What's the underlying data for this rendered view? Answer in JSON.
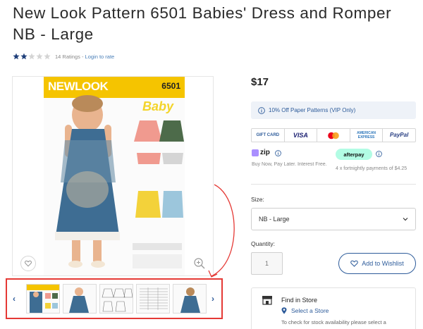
{
  "product": {
    "title": "New Look Pattern 6501 Babies' Dress and Romper NB - Large",
    "rating_stars_filled": 2,
    "rating_stars_total": 5,
    "ratings_text": "14 Ratings - ",
    "login_text": "Login to rate",
    "price": "$17"
  },
  "cover": {
    "brand": "NEWLOOK",
    "number": "6501",
    "baby": "Baby"
  },
  "promo": {
    "vip_text": "10% Off Paper Patterns (VIP Only)"
  },
  "payments": {
    "methods": [
      "GIFT CARD",
      "VISA",
      "mastercard",
      "AMERICAN EXPRESS",
      "PayPal"
    ],
    "zip_label": "zip",
    "zip_desc": "Buy Now, Pay Later. Interest Free.",
    "afterpay_label": "afterpay",
    "afterpay_desc": "4 x fortnightly payments of $4.25"
  },
  "options": {
    "size_label": "Size:",
    "size_value": "NB - Large",
    "quantity_label": "Quantity:",
    "quantity_value": "1",
    "wishlist_label": "Add to Wishlist"
  },
  "store": {
    "title": "Find in Store",
    "select_label": "Select a Store",
    "note": "To check for stock availability please select a"
  },
  "colors": {
    "accent": "#2d5b9a",
    "highlight": "#e53935",
    "star": "#1f3f7a",
    "cover_yellow": "#f5c400"
  }
}
